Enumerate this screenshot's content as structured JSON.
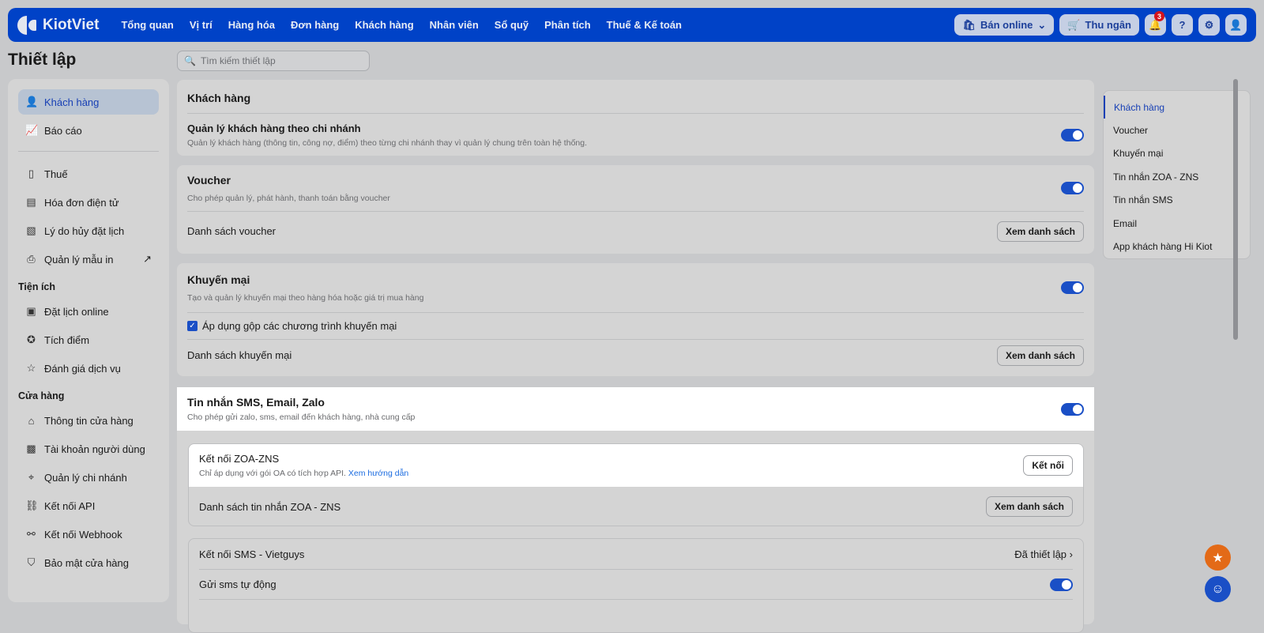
{
  "header": {
    "logo": "KiotViet",
    "nav": [
      "Tổng quan",
      "Vị trí",
      "Hàng hóa",
      "Đơn hàng",
      "Khách hàng",
      "Nhân viên",
      "Sổ quỹ",
      "Phân tích",
      "Thuế & Kế toán"
    ],
    "online": "Bán online",
    "cashier": "Thu ngân",
    "notif_count": "3"
  },
  "page_title": "Thiết lập",
  "search": {
    "placeholder": "Tìm kiếm thiết lập"
  },
  "sidebar": {
    "top": [
      "Khách hàng",
      "Báo cáo"
    ],
    "group1": [
      "Thuế",
      "Hóa đơn điện tử",
      "Lý do hủy đặt lịch",
      "Quản lý mẫu in"
    ],
    "util_title": "Tiện ích",
    "util": [
      "Đặt lịch online",
      "Tích điểm",
      "Đánh giá dịch vụ"
    ],
    "store_title": "Cửa hàng",
    "store": [
      "Thông tin cửa hàng",
      "Tài khoản người dùng",
      "Quản lý chi nhánh",
      "Kết nối API",
      "Kết nối Webhook",
      "Bảo mật cửa hàng"
    ]
  },
  "sections": {
    "customer": {
      "title": "Khách hàng",
      "item": "Quản lý khách hàng theo chi nhánh",
      "desc": "Quản lý khách hàng (thông tin, công nợ, điểm) theo từng chi nhánh thay vì quản lý chung trên toàn hệ thống.",
      "on": true
    },
    "voucher": {
      "title": "Voucher",
      "desc": "Cho phép quản lý, phát hành, thanh toán bằng voucher",
      "list": "Danh sách voucher",
      "btn": "Xem danh sách",
      "on": true
    },
    "promo": {
      "title": "Khuyến mại",
      "desc": "Tạo và quản lý khuyến mại theo hàng hóa hoặc giá trị mua hàng",
      "check": "Áp dụng gộp các chương trình khuyến mại",
      "checked": true,
      "list": "Danh sách khuyến mại",
      "btn": "Xem danh sách",
      "on": true
    },
    "msg": {
      "title": "Tin nhắn SMS, Email, Zalo",
      "desc": "Cho phép gửi zalo, sms, email đến khách hàng, nhà cung cấp",
      "on": true,
      "zns": {
        "title": "Kết nối ZOA-ZNS",
        "desc": "Chỉ áp dụng với gói OA có tích hợp API.",
        "link": "Xem hướng dẫn",
        "btn": "Kết nối",
        "list": "Danh sách tin nhắn ZOA - ZNS",
        "list_btn": "Xem danh sách"
      },
      "sms": {
        "title": "Kết nối SMS - Vietguys",
        "status": "Đã thiết lập",
        "auto": "Gửi sms tự động",
        "auto_on": true
      }
    }
  },
  "right_nav": [
    "Khách hàng",
    "Voucher",
    "Khuyến mại",
    "Tin nhắn ZOA - ZNS",
    "Tin nhắn SMS",
    "Email",
    "App khách hàng Hi Kiot"
  ]
}
